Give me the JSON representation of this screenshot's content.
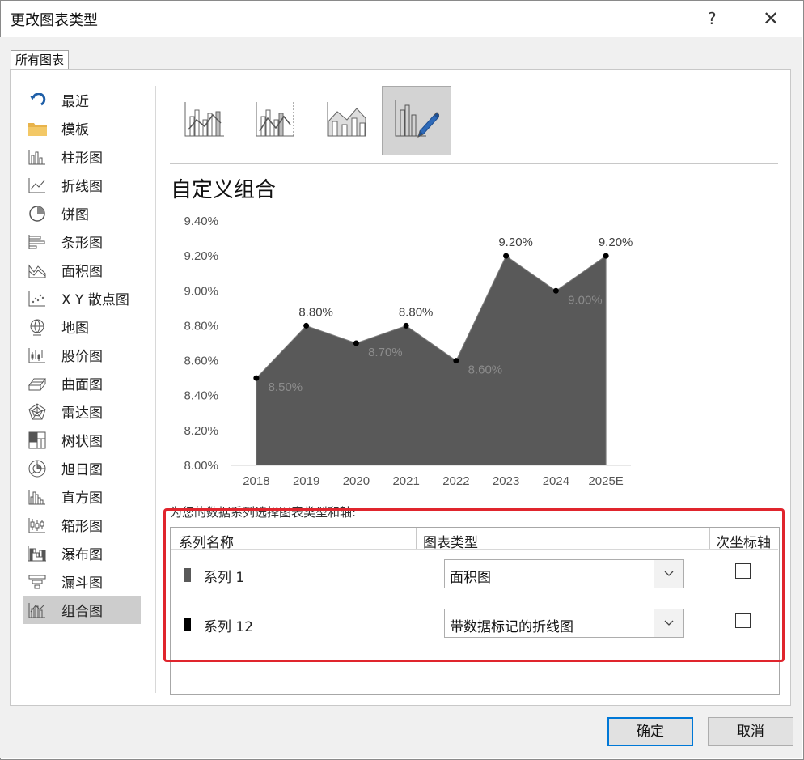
{
  "window": {
    "title": "更改图表类型",
    "help": "?",
    "close": "✕"
  },
  "tab": {
    "label": "所有图表"
  },
  "sidebar": {
    "items": [
      {
        "label": "最近",
        "icon": "recent-icon"
      },
      {
        "label": "模板",
        "icon": "folder-icon"
      },
      {
        "label": "柱形图",
        "icon": "column-chart-icon"
      },
      {
        "label": "折线图",
        "icon": "line-chart-icon"
      },
      {
        "label": "饼图",
        "icon": "pie-chart-icon"
      },
      {
        "label": "条形图",
        "icon": "bar-chart-icon"
      },
      {
        "label": "面积图",
        "icon": "area-chart-icon"
      },
      {
        "label": "X Y 散点图",
        "icon": "scatter-chart-icon"
      },
      {
        "label": "地图",
        "icon": "map-chart-icon"
      },
      {
        "label": "股价图",
        "icon": "stock-chart-icon"
      },
      {
        "label": "曲面图",
        "icon": "surface-chart-icon"
      },
      {
        "label": "雷达图",
        "icon": "radar-chart-icon"
      },
      {
        "label": "树状图",
        "icon": "treemap-chart-icon"
      },
      {
        "label": "旭日图",
        "icon": "sunburst-chart-icon"
      },
      {
        "label": "直方图",
        "icon": "histogram-chart-icon"
      },
      {
        "label": "箱形图",
        "icon": "boxwhisker-chart-icon"
      },
      {
        "label": "瀑布图",
        "icon": "waterfall-chart-icon"
      },
      {
        "label": "漏斗图",
        "icon": "funnel-chart-icon"
      },
      {
        "label": "组合图",
        "icon": "combo-chart-icon",
        "selected": true
      }
    ]
  },
  "subtypes": {
    "items": [
      {
        "icon": "clustered-column-line-icon"
      },
      {
        "icon": "clustered-column-line-secondary-axis-icon"
      },
      {
        "icon": "stacked-area-clustered-column-icon"
      },
      {
        "icon": "custom-combination-icon",
        "selected": true
      }
    ]
  },
  "main": {
    "heading": "自定义组合"
  },
  "chart_data": {
    "type": "area",
    "categories": [
      "2018",
      "2019",
      "2020",
      "2021",
      "2022",
      "2023",
      "2024",
      "2025E"
    ],
    "series": [
      {
        "type": "area",
        "values": [
          8.5,
          8.8,
          8.7,
          8.8,
          8.6,
          9.2,
          9.0,
          9.2
        ],
        "color": "#595959",
        "labels": [
          "8.50%",
          "8.80%",
          "8.70%",
          "8.80%",
          "8.60%",
          "9.20%",
          "9.00%",
          "9.20%"
        ]
      },
      {
        "type": "line-markers",
        "values": [
          8.5,
          8.8,
          8.7,
          8.8,
          8.6,
          9.2,
          9.0,
          9.2
        ],
        "color": "#000000"
      }
    ],
    "y_ticks": [
      "9.40%",
      "9.20%",
      "9.00%",
      "8.80%",
      "8.60%",
      "8.40%",
      "8.20%",
      "8.00%"
    ],
    "ylim": [
      8.0,
      9.4
    ],
    "grid": false,
    "legend": "none",
    "label_placement": {
      "above": [
        1,
        3,
        5,
        7
      ],
      "below": [
        0,
        2,
        4,
        6
      ]
    }
  },
  "series_config": {
    "instruction": "为您的数据系列选择图表类型和轴:",
    "headers": {
      "name": "系列名称",
      "type": "图表类型",
      "secondary": "次坐标轴"
    },
    "rows": [
      {
        "name": "系列 1",
        "swatch": "#595959",
        "chart_type": "面积图",
        "secondary_axis": false
      },
      {
        "name": "系列 12",
        "swatch": "#000000",
        "chart_type": "带数据标记的折线图",
        "secondary_axis": false
      }
    ]
  },
  "buttons": {
    "ok": "确定",
    "cancel": "取消"
  },
  "colors": {
    "highlight": "#e0252d",
    "selected_bg": "#cdcdcd",
    "primary_border": "#0078d7"
  }
}
